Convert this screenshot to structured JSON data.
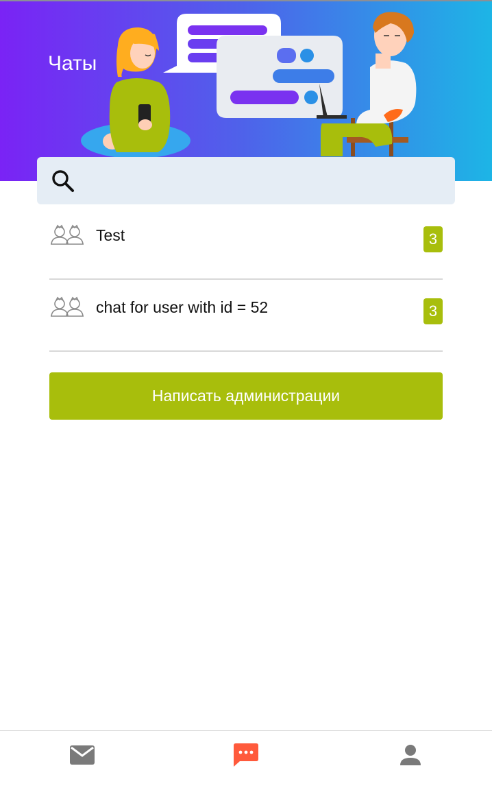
{
  "header": {
    "title": "Чаты"
  },
  "search": {
    "placeholder": "",
    "value": "",
    "icon": "search-icon"
  },
  "chats": [
    {
      "name": "Test",
      "unread": "3",
      "icon": "group-icon"
    },
    {
      "name": "chat for user with id = 52",
      "unread": "3",
      "icon": "group-icon"
    }
  ],
  "admin_button": {
    "label": "Написать администрации"
  },
  "bottom_nav": {
    "items": [
      {
        "icon": "mail-icon",
        "active": false
      },
      {
        "icon": "chat-icon",
        "active": true
      },
      {
        "icon": "person-icon",
        "active": false
      }
    ]
  },
  "colors": {
    "accent_green": "#a8be0c",
    "active_nav": "#ff5a3c",
    "inactive_nav": "#7a7a7a",
    "search_bg": "#e5edf5",
    "header_gradient_start": "#7a23f5",
    "header_gradient_end": "#1db5e6"
  }
}
